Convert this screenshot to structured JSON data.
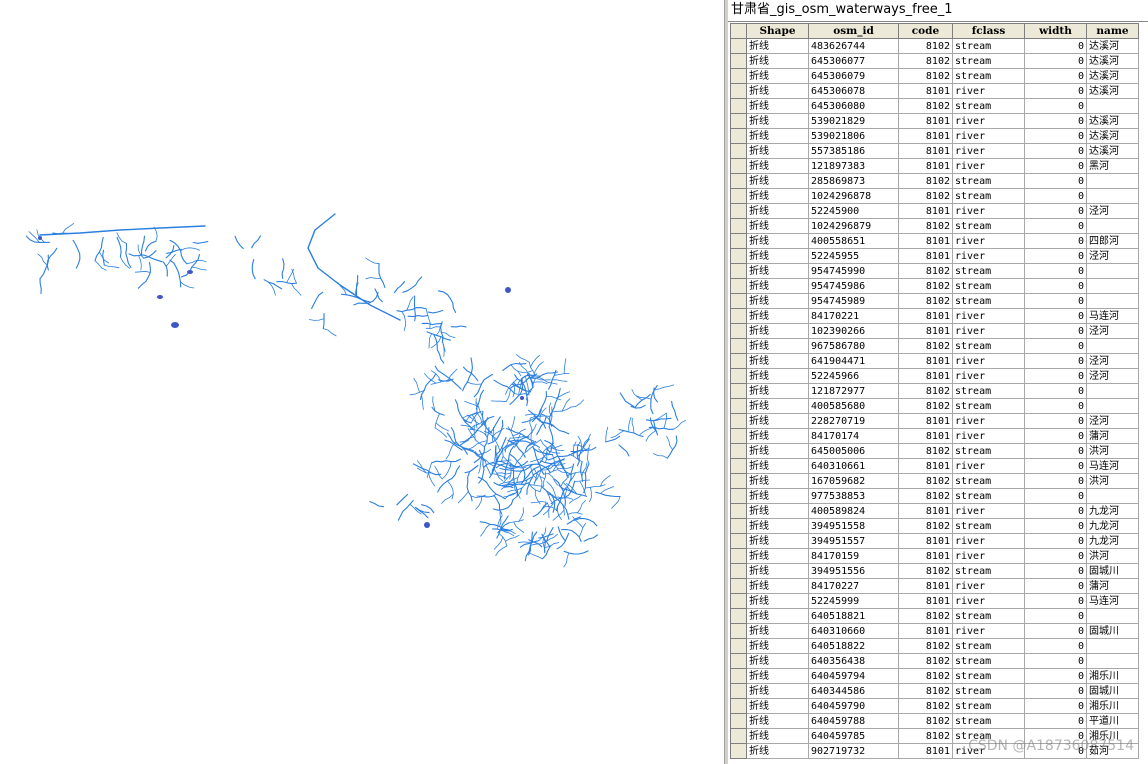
{
  "window": {
    "title": "甘肃省_gis_osm_waterways_free_1"
  },
  "map": {
    "river_color": "#2b7fe0",
    "lake_color": "#3f56c8",
    "background": "#ffffff"
  },
  "table": {
    "columns": [
      "Shape",
      "osm_id",
      "code",
      "fclass",
      "width",
      "name"
    ],
    "rows": [
      [
        "折线",
        "483626744",
        "8102",
        "stream",
        "0",
        "达溪河"
      ],
      [
        "折线",
        "645306077",
        "8102",
        "stream",
        "0",
        "达溪河"
      ],
      [
        "折线",
        "645306079",
        "8102",
        "stream",
        "0",
        "达溪河"
      ],
      [
        "折线",
        "645306078",
        "8101",
        "river",
        "0",
        "达溪河"
      ],
      [
        "折线",
        "645306080",
        "8102",
        "stream",
        "0",
        ""
      ],
      [
        "折线",
        "539021829",
        "8101",
        "river",
        "0",
        "达溪河"
      ],
      [
        "折线",
        "539021806",
        "8101",
        "river",
        "0",
        "达溪河"
      ],
      [
        "折线",
        "557385186",
        "8101",
        "river",
        "0",
        "达溪河"
      ],
      [
        "折线",
        "121897383",
        "8101",
        "river",
        "0",
        "黑河"
      ],
      [
        "折线",
        "285869873",
        "8102",
        "stream",
        "0",
        ""
      ],
      [
        "折线",
        "1024296878",
        "8102",
        "stream",
        "0",
        ""
      ],
      [
        "折线",
        "52245900",
        "8101",
        "river",
        "0",
        "泾河"
      ],
      [
        "折线",
        "1024296879",
        "8102",
        "stream",
        "0",
        ""
      ],
      [
        "折线",
        "400558651",
        "8101",
        "river",
        "0",
        "四郎河"
      ],
      [
        "折线",
        "52245955",
        "8101",
        "river",
        "0",
        "泾河"
      ],
      [
        "折线",
        "954745990",
        "8102",
        "stream",
        "0",
        ""
      ],
      [
        "折线",
        "954745986",
        "8102",
        "stream",
        "0",
        ""
      ],
      [
        "折线",
        "954745989",
        "8102",
        "stream",
        "0",
        ""
      ],
      [
        "折线",
        "84170221",
        "8101",
        "river",
        "0",
        "马连河"
      ],
      [
        "折线",
        "102390266",
        "8101",
        "river",
        "0",
        "泾河"
      ],
      [
        "折线",
        "967586780",
        "8102",
        "stream",
        "0",
        ""
      ],
      [
        "折线",
        "641904471",
        "8101",
        "river",
        "0",
        "泾河"
      ],
      [
        "折线",
        "52245966",
        "8101",
        "river",
        "0",
        "泾河"
      ],
      [
        "折线",
        "121872977",
        "8102",
        "stream",
        "0",
        ""
      ],
      [
        "折线",
        "400585680",
        "8102",
        "stream",
        "0",
        ""
      ],
      [
        "折线",
        "228270719",
        "8101",
        "river",
        "0",
        "泾河"
      ],
      [
        "折线",
        "84170174",
        "8101",
        "river",
        "0",
        "蒲河"
      ],
      [
        "折线",
        "645005006",
        "8102",
        "stream",
        "0",
        "洪河"
      ],
      [
        "折线",
        "640310661",
        "8101",
        "river",
        "0",
        "马连河"
      ],
      [
        "折线",
        "167059682",
        "8102",
        "stream",
        "0",
        "洪河"
      ],
      [
        "折线",
        "977538853",
        "8102",
        "stream",
        "0",
        ""
      ],
      [
        "折线",
        "400589824",
        "8101",
        "river",
        "0",
        "九龙河"
      ],
      [
        "折线",
        "394951558",
        "8102",
        "stream",
        "0",
        "九龙河"
      ],
      [
        "折线",
        "394951557",
        "8101",
        "river",
        "0",
        "九龙河"
      ],
      [
        "折线",
        "84170159",
        "8101",
        "river",
        "0",
        "洪河"
      ],
      [
        "折线",
        "394951556",
        "8102",
        "stream",
        "0",
        "固城川"
      ],
      [
        "折线",
        "84170227",
        "8101",
        "river",
        "0",
        "蒲河"
      ],
      [
        "折线",
        "52245999",
        "8101",
        "river",
        "0",
        "马连河"
      ],
      [
        "折线",
        "640518821",
        "8102",
        "stream",
        "0",
        ""
      ],
      [
        "折线",
        "640310660",
        "8101",
        "river",
        "0",
        "固城川"
      ],
      [
        "折线",
        "640518822",
        "8102",
        "stream",
        "0",
        ""
      ],
      [
        "折线",
        "640356438",
        "8102",
        "stream",
        "0",
        ""
      ],
      [
        "折线",
        "640459794",
        "8102",
        "stream",
        "0",
        "湘乐川"
      ],
      [
        "折线",
        "640344586",
        "8102",
        "stream",
        "0",
        "固城川"
      ],
      [
        "折线",
        "640459790",
        "8102",
        "stream",
        "0",
        "湘乐川"
      ],
      [
        "折线",
        "640459788",
        "8102",
        "stream",
        "0",
        "平道川"
      ],
      [
        "折线",
        "640459785",
        "8102",
        "stream",
        "0",
        "湘乐川"
      ],
      [
        "折线",
        "902719732",
        "8101",
        "river",
        "0",
        "茹河"
      ]
    ]
  },
  "watermark": "CSDN @A18736087514"
}
